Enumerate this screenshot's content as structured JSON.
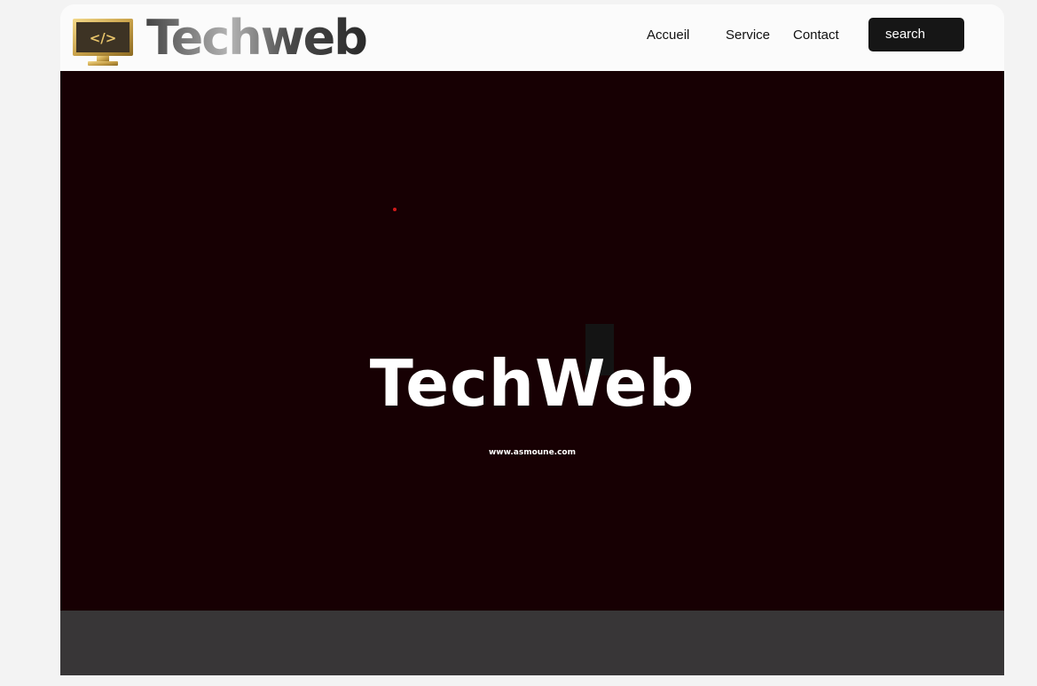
{
  "header": {
    "brand": "Techweb",
    "logo_icon": "monitor-code-icon",
    "nav": [
      {
        "label": "Accueil"
      },
      {
        "label": "Service"
      },
      {
        "label": "Contact"
      }
    ],
    "search_label": "search"
  },
  "hero": {
    "title": "TechWeb",
    "subtitle": "www.asmoune.com"
  },
  "colors": {
    "hero_background": "#170003",
    "footer_background": "#383637",
    "search_button": "#161616",
    "logo_gold": "#c9a24a"
  }
}
